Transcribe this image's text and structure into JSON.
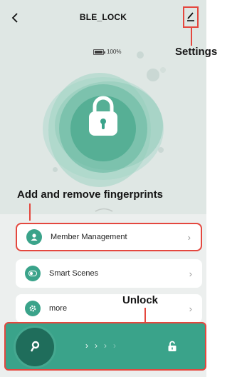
{
  "header": {
    "title": "BLE_LOCK",
    "back_icon": "chevron-left-icon",
    "edit_icon": "pencil-icon"
  },
  "battery": {
    "level_percent": 100,
    "label": "100%"
  },
  "annotations": {
    "settings": "Settings",
    "fingerprints": "Add and remove fingerprints",
    "unlock": "Unlock"
  },
  "menu": {
    "items": [
      {
        "label": "Member Management",
        "icon": "person-icon"
      },
      {
        "label": "Smart Scenes",
        "icon": "toggle-icon"
      },
      {
        "label": "more",
        "icon": "gear-icon"
      }
    ]
  },
  "slider": {
    "arrow_count": 4,
    "knob_icon": "key-icon",
    "end_icon": "unlocked-padlock-icon"
  },
  "colors": {
    "accent": "#3aa38a",
    "dark_accent": "#1f6d5b",
    "annotation": "#e4473e",
    "background": "#dfe7e4"
  }
}
